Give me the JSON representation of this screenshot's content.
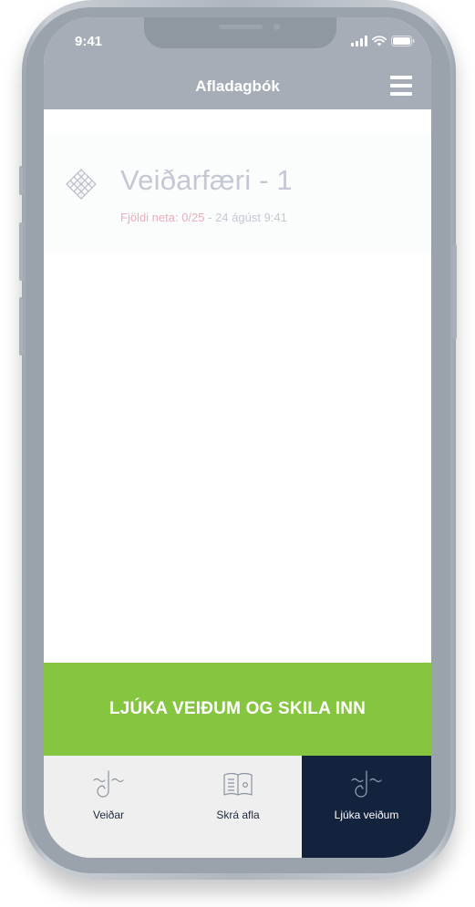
{
  "status_bar": {
    "time": "9:41"
  },
  "header": {
    "title": "Afladagbók",
    "menu_icon": "hamburger-menu-icon"
  },
  "gear": {
    "name": "Veiðarfæri - 1",
    "count_text": "Fjöldi neta: 0/25",
    "separator": " - ",
    "timestamp": "24 ágúst 9:41",
    "icon": "net-icon"
  },
  "action": {
    "finish_label": "LJÚKA VEIÐUM OG SKILA INN"
  },
  "tabs": [
    {
      "label": "Veiðar",
      "icon": "fishing-hook-icon",
      "active": false
    },
    {
      "label": "Skrá afla",
      "icon": "logbook-icon",
      "active": false
    },
    {
      "label": "Ljúka veiðum",
      "icon": "fishing-hook-icon",
      "active": true
    }
  ],
  "colors": {
    "header_bg": "#a6adb7",
    "finish_green": "#85c540",
    "active_tab_bg": "#14233d",
    "count_pink": "#e6b0bc"
  }
}
